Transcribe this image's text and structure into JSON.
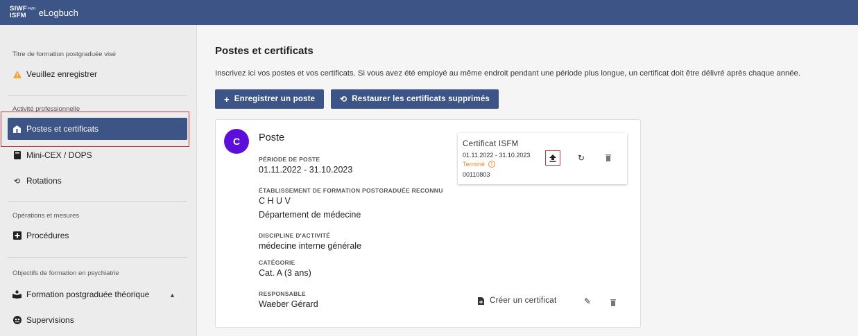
{
  "header": {
    "logo_top": "SIWF",
    "logo_top_sub": "FMH",
    "logo_bottom": "ISFM",
    "app_title": "eLogbuch"
  },
  "sidebar": {
    "section1_title": "Titre de formation postgraduée visé",
    "register_title_label": "Veuillez enregistrer",
    "section2_title": "Activité professionnelle",
    "items_activity": [
      {
        "label": "Postes et certificats",
        "icon": "hospital-icon"
      },
      {
        "label": "Mini-CEX / DOPS",
        "icon": "book-icon"
      },
      {
        "label": "Rotations",
        "icon": "rotate-icon"
      }
    ],
    "section3_title": "Opérations et mesures",
    "items_operations": [
      {
        "label": "Procédures",
        "icon": "plus-square-icon"
      }
    ],
    "section4_title": "Objectifs de formation en psychiatrie",
    "items_objectives": [
      {
        "label": "Formation postgraduée théorique",
        "icon": "reading-icon"
      },
      {
        "label": "Supervisions",
        "icon": "supervision-icon"
      }
    ]
  },
  "main": {
    "page_title": "Postes et certificats",
    "intro": "Inscrivez ici vos postes et vos certificats. Si vous avez été employé au même endroit pendant une période plus longue, un certificat doit être délivré après chaque année.",
    "register_button": "Enregistrer un poste",
    "restore_button": "Restaurer les certificats supprimés"
  },
  "card": {
    "avatar": "C",
    "title": "Poste",
    "period_label": "PÉRIODE DE POSTE",
    "period_value": "01.11.2022 - 31.10.2023",
    "institution_label": "ÉTABLISSEMENT DE FORMATION POSTGRADUÉE RECONNU",
    "institution_value": "C H U V",
    "department_value": "Département de médecine",
    "discipline_label": "DISCIPLINE D'ACTIVITÉ",
    "discipline_value": "médecine interne générale",
    "category_label": "CATÉGORIE",
    "category_value": "Cat. A (3 ans)",
    "responsible_label": "RESPONSABLE",
    "responsible_value": "Waeber Gérard",
    "create_certificate": "Créer un certificat"
  },
  "certificate": {
    "title": "Certificat ISFM",
    "dates": "01.11.2022 - 31.10.2023",
    "status": "Terminé",
    "number": "00110803"
  },
  "colors": {
    "primary": "#3d5486",
    "avatar": "#5b0fd8",
    "status": "#e88a2b",
    "highlight": "#c9373d"
  }
}
